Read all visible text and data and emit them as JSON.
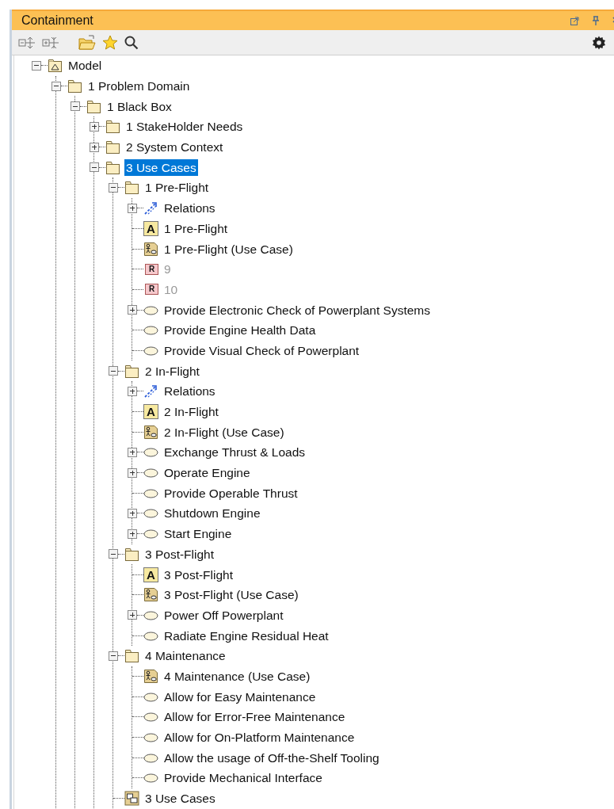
{
  "panel": {
    "title": "Containment"
  },
  "tree": [
    {
      "label": "Model",
      "kind": "model",
      "expanded": true,
      "selected": false,
      "disabled": false,
      "children": [
        {
          "label": "1 Problem Domain",
          "kind": "package",
          "expanded": true,
          "selected": false,
          "disabled": false,
          "children": [
            {
              "label": "1 Black Box",
              "kind": "package",
              "expanded": true,
              "selected": false,
              "disabled": false,
              "children": [
                {
                  "label": "1 StakeHolder Needs",
                  "kind": "package",
                  "expanded": false,
                  "selected": false,
                  "disabled": false
                },
                {
                  "label": "2 System Context",
                  "kind": "package",
                  "expanded": false,
                  "selected": false,
                  "disabled": false
                },
                {
                  "label": "3 Use Cases",
                  "kind": "package",
                  "expanded": true,
                  "selected": true,
                  "disabled": false,
                  "children": [
                    {
                      "label": "1 Pre-Flight",
                      "kind": "package",
                      "expanded": true,
                      "selected": false,
                      "disabled": false,
                      "children": [
                        {
                          "label": "Relations",
                          "kind": "relations",
                          "expanded": false,
                          "selected": false,
                          "disabled": false
                        },
                        {
                          "label": "1 Pre-Flight",
                          "kind": "text",
                          "icon_text": "A",
                          "selected": false,
                          "disabled": false
                        },
                        {
                          "label": "1 Pre-Flight (Use Case)",
                          "kind": "diagram",
                          "selected": false,
                          "disabled": false
                        },
                        {
                          "label": "9",
                          "kind": "requirement",
                          "icon_text": "R",
                          "selected": false,
                          "disabled": true
                        },
                        {
                          "label": "10",
                          "kind": "requirement",
                          "icon_text": "R",
                          "selected": false,
                          "disabled": true
                        },
                        {
                          "label": "Provide Electronic Check of Powerplant Systems",
                          "kind": "usecase",
                          "expanded": false,
                          "selected": false,
                          "disabled": false
                        },
                        {
                          "label": "Provide Engine Health Data",
                          "kind": "usecase",
                          "selected": false,
                          "disabled": false
                        },
                        {
                          "label": "Provide Visual Check of Powerplant",
                          "kind": "usecase",
                          "selected": false,
                          "disabled": false
                        }
                      ]
                    },
                    {
                      "label": "2 In-Flight",
                      "kind": "package",
                      "expanded": true,
                      "selected": false,
                      "disabled": false,
                      "children": [
                        {
                          "label": "Relations",
                          "kind": "relations",
                          "expanded": false,
                          "selected": false,
                          "disabled": false
                        },
                        {
                          "label": "2 In-Flight",
                          "kind": "text",
                          "icon_text": "A",
                          "selected": false,
                          "disabled": false
                        },
                        {
                          "label": "2 In-Flight (Use Case)",
                          "kind": "diagram",
                          "selected": false,
                          "disabled": false
                        },
                        {
                          "label": "Exchange Thrust & Loads",
                          "kind": "usecase",
                          "expanded": false,
                          "selected": false,
                          "disabled": false
                        },
                        {
                          "label": "Operate Engine",
                          "kind": "usecase",
                          "expanded": false,
                          "selected": false,
                          "disabled": false
                        },
                        {
                          "label": "Provide Operable Thrust",
                          "kind": "usecase",
                          "selected": false,
                          "disabled": false
                        },
                        {
                          "label": "Shutdown Engine",
                          "kind": "usecase",
                          "expanded": false,
                          "selected": false,
                          "disabled": false
                        },
                        {
                          "label": "Start Engine",
                          "kind": "usecase",
                          "expanded": false,
                          "selected": false,
                          "disabled": false
                        }
                      ]
                    },
                    {
                      "label": "3 Post-Flight",
                      "kind": "package",
                      "expanded": true,
                      "selected": false,
                      "disabled": false,
                      "children": [
                        {
                          "label": "3 Post-Flight",
                          "kind": "text",
                          "icon_text": "A",
                          "selected": false,
                          "disabled": false
                        },
                        {
                          "label": "3 Post-Flight (Use Case)",
                          "kind": "diagram",
                          "selected": false,
                          "disabled": false
                        },
                        {
                          "label": "Power Off Powerplant",
                          "kind": "usecase",
                          "expanded": false,
                          "selected": false,
                          "disabled": false
                        },
                        {
                          "label": "Radiate Engine Residual Heat",
                          "kind": "usecase",
                          "selected": false,
                          "disabled": false
                        }
                      ]
                    },
                    {
                      "label": "4 Maintenance",
                      "kind": "package",
                      "expanded": true,
                      "selected": false,
                      "disabled": false,
                      "children": [
                        {
                          "label": "4 Maintenance (Use Case)",
                          "kind": "diagram",
                          "selected": false,
                          "disabled": false
                        },
                        {
                          "label": "Allow for Easy Maintenance",
                          "kind": "usecase",
                          "selected": false,
                          "disabled": false
                        },
                        {
                          "label": "Allow for Error-Free Maintenance",
                          "kind": "usecase",
                          "selected": false,
                          "disabled": false
                        },
                        {
                          "label": "Allow for On-Platform Maintenance",
                          "kind": "usecase",
                          "selected": false,
                          "disabled": false
                        },
                        {
                          "label": "Allow the usage of Off-the-Shelf Tooling",
                          "kind": "usecase",
                          "selected": false,
                          "disabled": false
                        },
                        {
                          "label": "Provide Mechanical Interface",
                          "kind": "usecase",
                          "selected": false,
                          "disabled": false
                        }
                      ]
                    },
                    {
                      "label": "3 Use Cases",
                      "kind": "package_diagram",
                      "selected": false,
                      "disabled": false
                    }
                  ]
                }
              ]
            }
          ]
        }
      ]
    }
  ]
}
